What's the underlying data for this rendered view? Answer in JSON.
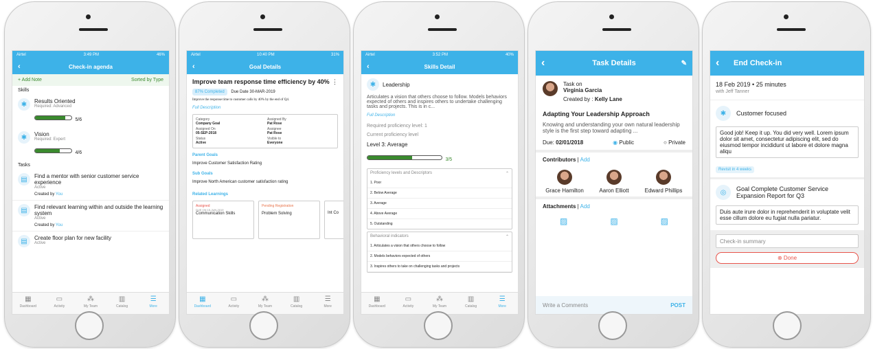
{
  "s1": {
    "carrier": "Airtel",
    "time": "3:49 PM",
    "battery": "46%",
    "title": "Check-in agenda",
    "add": "+ Add Note",
    "sort": "Sorted by Type",
    "skills_h": "Skills",
    "skills": [
      {
        "name": "Results Oriented",
        "req": "Required: Advanced",
        "score": "5/6",
        "fill": 0.83
      },
      {
        "name": "Vision",
        "req": "Required: Expert",
        "score": "4/6",
        "fill": 0.67
      }
    ],
    "tasks_h": "Tasks",
    "tasks": [
      {
        "name": "Find a mentor with senior customer service experience",
        "status": "Active",
        "by": "Created by",
        "who": "You"
      },
      {
        "name": "Find relevant learning within and outside the learning system",
        "status": "Active",
        "by": "Created by",
        "who": "You"
      },
      {
        "name": "Create floor plan for new facility",
        "status": "Active"
      }
    ]
  },
  "tabs": [
    "Dashboard",
    "Activity",
    "My Team",
    "Catalog",
    "More"
  ],
  "s2": {
    "carrier": "Airtel",
    "time": "10:40 PM",
    "battery": "31%",
    "title": "Goal Details",
    "goal": "Improve team response time efficiency by 40%",
    "pct": "87% Completed",
    "due": "Due Date 30-MAR-2019",
    "desc": "Improve the response time to customer calls by 40% by the end of Q4.",
    "full": "Full Description",
    "fields": [
      [
        "Category",
        "Company Goal"
      ],
      [
        "Assigned By",
        "Pat Rose"
      ],
      [
        "Assigned On",
        "05-SEP-2018"
      ],
      [
        "Assignee",
        "Pat Rose"
      ],
      [
        "Status",
        "Active"
      ],
      [
        "Visible to",
        "Everyone"
      ]
    ],
    "parent_h": "Parent Goals",
    "parent": "Improve Customer Satisfaction Rating",
    "sub_h": "Sub Goals",
    "sub": "Improve North American customer satisfaction rating",
    "rel_h": "Related Learnings",
    "learn": [
      {
        "badge": "Assigned",
        "due": "DUE ON 15-JUN-2019",
        "name": "Communication Skills"
      },
      {
        "badge": "Pending Registration",
        "due": "",
        "name": "Problem Solving"
      },
      {
        "badge": "",
        "due": "",
        "name": "Int Co"
      }
    ]
  },
  "s3": {
    "carrier": "Airtel",
    "time": "3:52 PM",
    "battery": "40%",
    "title": "Skills Detail",
    "skill": "Leadership",
    "desc": "Articulates a vision that others choose to follow. Models behaviors expected of others and inspires others to undertake challenging tasks and projects. This is in c...",
    "full": "Full Description",
    "req": "Required proficiency level: 1",
    "cur": "Current proficiency level",
    "lvl": "Level 3: Average",
    "score": "3/5",
    "fill": 0.6,
    "prof_h": "Proficiency levels and Descriptors",
    "prof": [
      "1. Poor",
      "2. Below Average",
      "3. Average",
      "4. Above Average",
      "5. Outstanding"
    ],
    "beh_h": "Behavioral indicators",
    "beh": [
      "1. Articulates a vision that others choose to follow",
      "2. Models behaviors expected of others",
      "3. Inspires others to take on challenging tasks and projects"
    ]
  },
  "s4": {
    "title": "Task Details",
    "task_on": "Task on",
    "person": "Virginia Garcia",
    "created": "Created by : ",
    "creator": "Kelly Lane",
    "heading": "Adapting Your Leadership Approach",
    "body": "Knowing and understanding your own natural leadership style is the first step toward adapting ...",
    "due_l": "Due: ",
    "due": "02/01/2018",
    "public": "Public",
    "private": "Private",
    "contrib": "Contributors",
    "add": "Add",
    "people": [
      "Grace Hamilton",
      "Aaron Elliott",
      "Edward Phillips"
    ],
    "attach": "Attachments",
    "comment": "Write a Comments",
    "post": "POST"
  },
  "s5": {
    "title": "End Check-in",
    "date": "18 Feb 2019 • 25 minutes",
    "with": "with Jeff Tanner",
    "skill": "Customer focused",
    "note": "Good job! Keep it up. You did very well. Lorem ipsum dolor sit amet, consectetur adipiscing elit, sed do eiusmod tempor incididunt ut labore et dolore magna aliqu",
    "revisit": "Revisit in 4 weeks",
    "goal": "Goal Complete Customer Service Expansion Report for Q3",
    "gnote": "Duis aute irure dolor in reprehenderit in voluptate velit esse cillum dolore eu fugiat nulla pariatur.",
    "summary": "Check-in summary",
    "done": "Done"
  },
  "colors": {
    "accent": "#3db2e8",
    "progress": "#3a8a2e",
    "done": "#e8534a"
  }
}
